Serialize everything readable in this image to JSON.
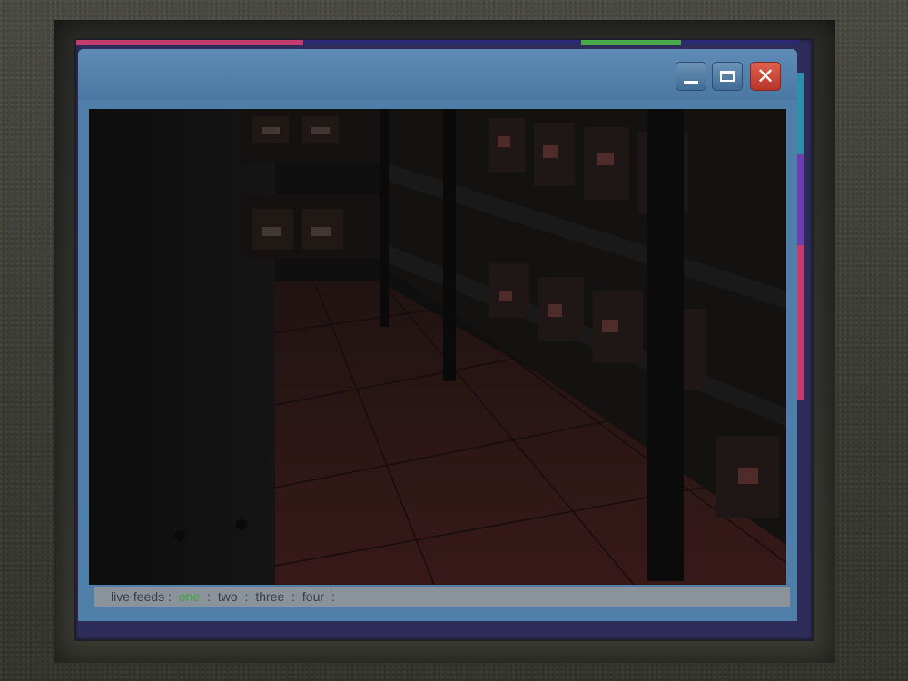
{
  "window": {
    "controls": {
      "minimize_icon": "minimize-icon",
      "maximize_icon": "maximize-icon",
      "close_icon": "close-icon",
      "close_glyph": "✕"
    }
  },
  "camera_view": {
    "scene": "storage room with shelves of boxes and tiled floor"
  },
  "status_bar": {
    "prefix": "live feeds :",
    "feeds": [
      {
        "label": "one",
        "active": true
      },
      {
        "label": "two",
        "active": false
      },
      {
        "label": "three",
        "active": false
      },
      {
        "label": "four",
        "active": false
      }
    ],
    "separator": ":"
  },
  "colors": {
    "active_feed": "#3fa53f",
    "window_blue": "#4f7ea8",
    "close_red": "#c8402f",
    "frame_pink": "#c23c6c",
    "frame_green": "#4aa84a",
    "frame_navy": "#2b2a70"
  }
}
